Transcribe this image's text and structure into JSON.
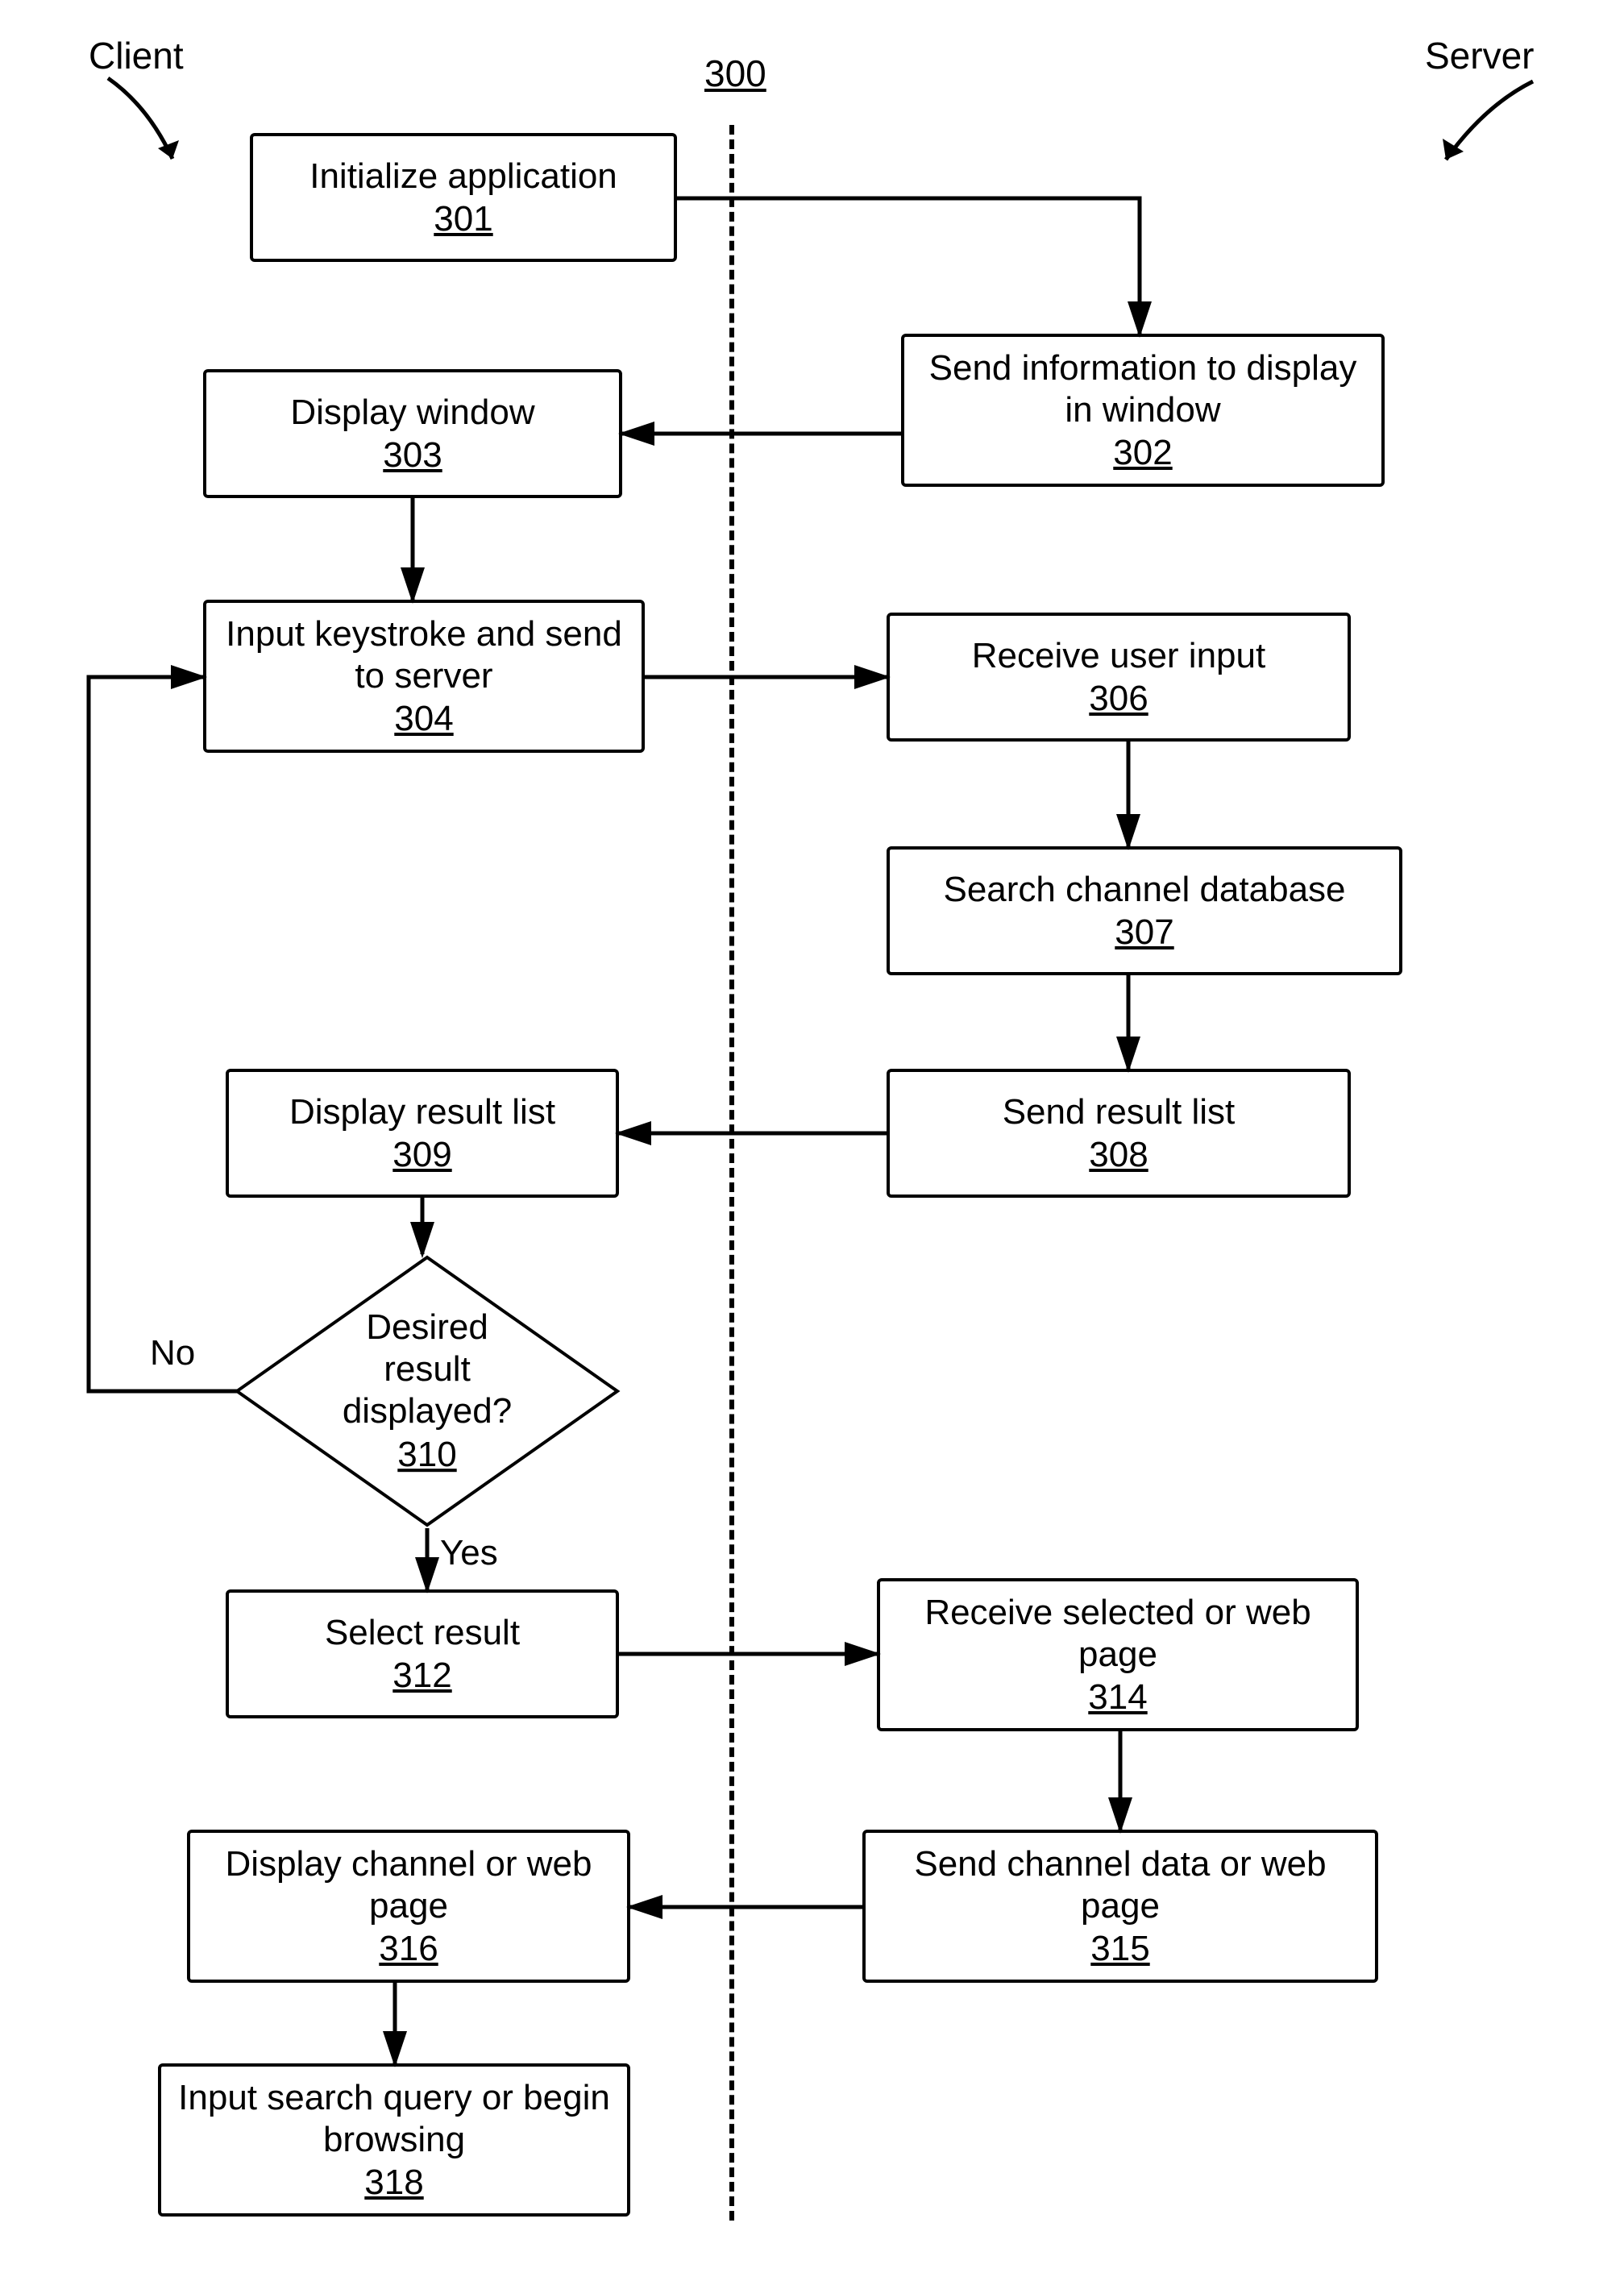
{
  "header": {
    "client_label": "Client",
    "server_label": "Server",
    "diagram_number": "300"
  },
  "boxes": {
    "b301": {
      "title": "Initialize application",
      "num": "301"
    },
    "b302": {
      "title": "Send information to display in window",
      "num": "302"
    },
    "b303": {
      "title": "Display window",
      "num": "303"
    },
    "b304": {
      "title": "Input keystroke and send to server",
      "num": "304"
    },
    "b306": {
      "title": "Receive user input",
      "num": "306"
    },
    "b307": {
      "title": "Search channel database",
      "num": "307"
    },
    "b308": {
      "title": "Send result list",
      "num": "308"
    },
    "b309": {
      "title": "Display result list",
      "num": "309"
    },
    "b312": {
      "title": "Select result",
      "num": "312"
    },
    "b314": {
      "title": "Receive selected or web page",
      "num": "314"
    },
    "b315": {
      "title": "Send channel data or web page",
      "num": "315"
    },
    "b316": {
      "title": "Display channel or web page",
      "num": "316"
    },
    "b318": {
      "title": "Input search query or begin browsing",
      "num": "318"
    }
  },
  "decision": {
    "d310": {
      "line1": "Desired result",
      "line2": "displayed?",
      "num": "310"
    }
  },
  "edge_labels": {
    "no": "No",
    "yes": "Yes"
  }
}
